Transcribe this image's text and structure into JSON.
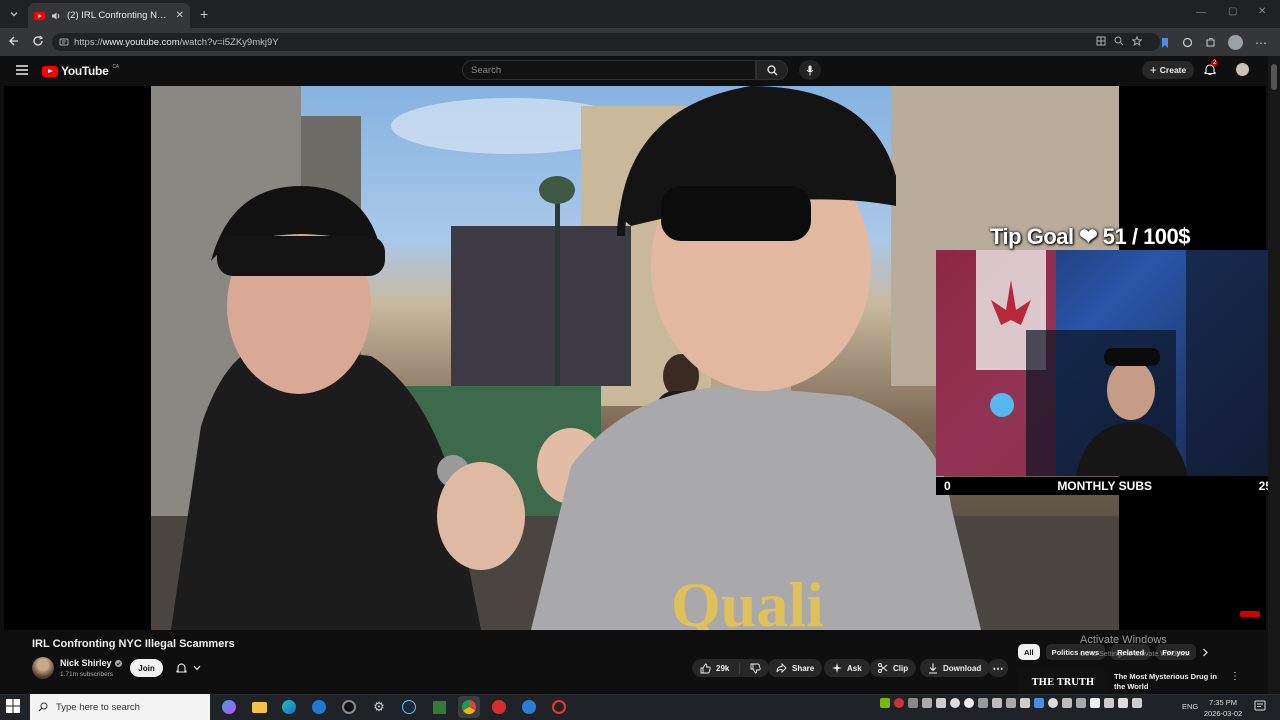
{
  "browser": {
    "tab_title": "(2) IRL Confronting NYC Illegal Scammers",
    "url_prefix": "https://",
    "url_host": "www.youtube.com",
    "url_path": "/watch?v=i5ZKy9mkj9Y"
  },
  "youtube": {
    "logo_text": "YouTube",
    "logo_region": "CA",
    "search_placeholder": "Search",
    "create_label": "Create",
    "notification_count": "2"
  },
  "video": {
    "tip_goal": "Tip Goal ❤ 51 / 100$",
    "subs_left": "0",
    "subs_label": "MONTHLY SUBS",
    "subs_right": "25",
    "title": "IRL Confronting NYC Illegal Scammers"
  },
  "channel": {
    "name": "Nick Shirley",
    "subscribers": "1.71m subscribers",
    "join_label": "Join"
  },
  "actions": {
    "likes": "29k",
    "share": "Share",
    "ask": "Ask",
    "clip": "Clip",
    "download": "Download"
  },
  "sidebar": {
    "chips": [
      "All",
      "Politics news",
      "Related",
      "For you"
    ],
    "rec_thumb_text": "THE TRUTH",
    "rec_title": "The Most Mysterious Drug in the World"
  },
  "watermark": {
    "title": "Activate Windows",
    "subtitle": "Go to Settings to activate Windows."
  },
  "taskbar": {
    "search_placeholder": "Type here to search",
    "language": "ENG",
    "time": "7:35 PM",
    "date": "2026-03-02"
  },
  "colors": {
    "youtube_red": "#ff0000",
    "background": "#0f0f0f",
    "pill": "#272727"
  }
}
